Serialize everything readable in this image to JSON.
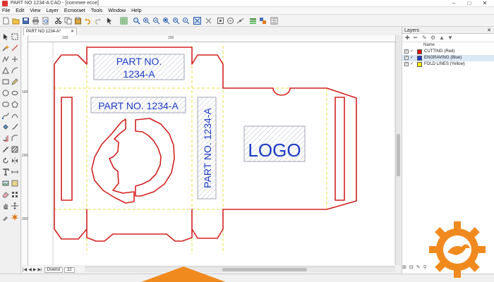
{
  "window": {
    "title": "PART NO 1234-A CAD - [commee ecce]",
    "controls": [
      "–",
      "□",
      "✕"
    ]
  },
  "menu": [
    "File",
    "Edit",
    "View",
    "Layer",
    "Ecmoraet",
    "Tools",
    "Window",
    "Help"
  ],
  "doc_tab": {
    "label": "PART NO 1234-A*",
    "close": "✕"
  },
  "ruler": {
    "h": [
      "100",
      "200"
    ],
    "v": [
      "100",
      "200",
      "300"
    ]
  },
  "drawing": {
    "part_label_top": [
      "PART NO.",
      "1234-A"
    ],
    "part_label_mid": "PART NO. 1234-A",
    "part_label_vertical": "PART NO. 1234-A",
    "logo": "LOGO"
  },
  "sheet": {
    "nav": [
      "|◀",
      "◀",
      "▶",
      "▶|"
    ],
    "tab": "Dswnd",
    "tab2": "22"
  },
  "layers": {
    "title": "Layers",
    "close": "✕",
    "tools": [
      "✚",
      "━",
      "✎",
      "⚙",
      "▲",
      "▼"
    ],
    "col_name": "Name",
    "items": [
      {
        "name": "CUTTING (Red)",
        "color": "#e01010"
      },
      {
        "name": "ENGRAVING (Blue)",
        "color": "#1c3ac4"
      },
      {
        "name": "FOLD LINES (Yellow)",
        "color": "#ffee00"
      }
    ],
    "bottom": [
      "⊞",
      "⊟",
      "✎",
      "⚲"
    ]
  },
  "colors": {
    "cut": "#d42020",
    "engrave": "#1c3ac4",
    "fold": "#e6e23a",
    "orange": "#f08a1f"
  }
}
